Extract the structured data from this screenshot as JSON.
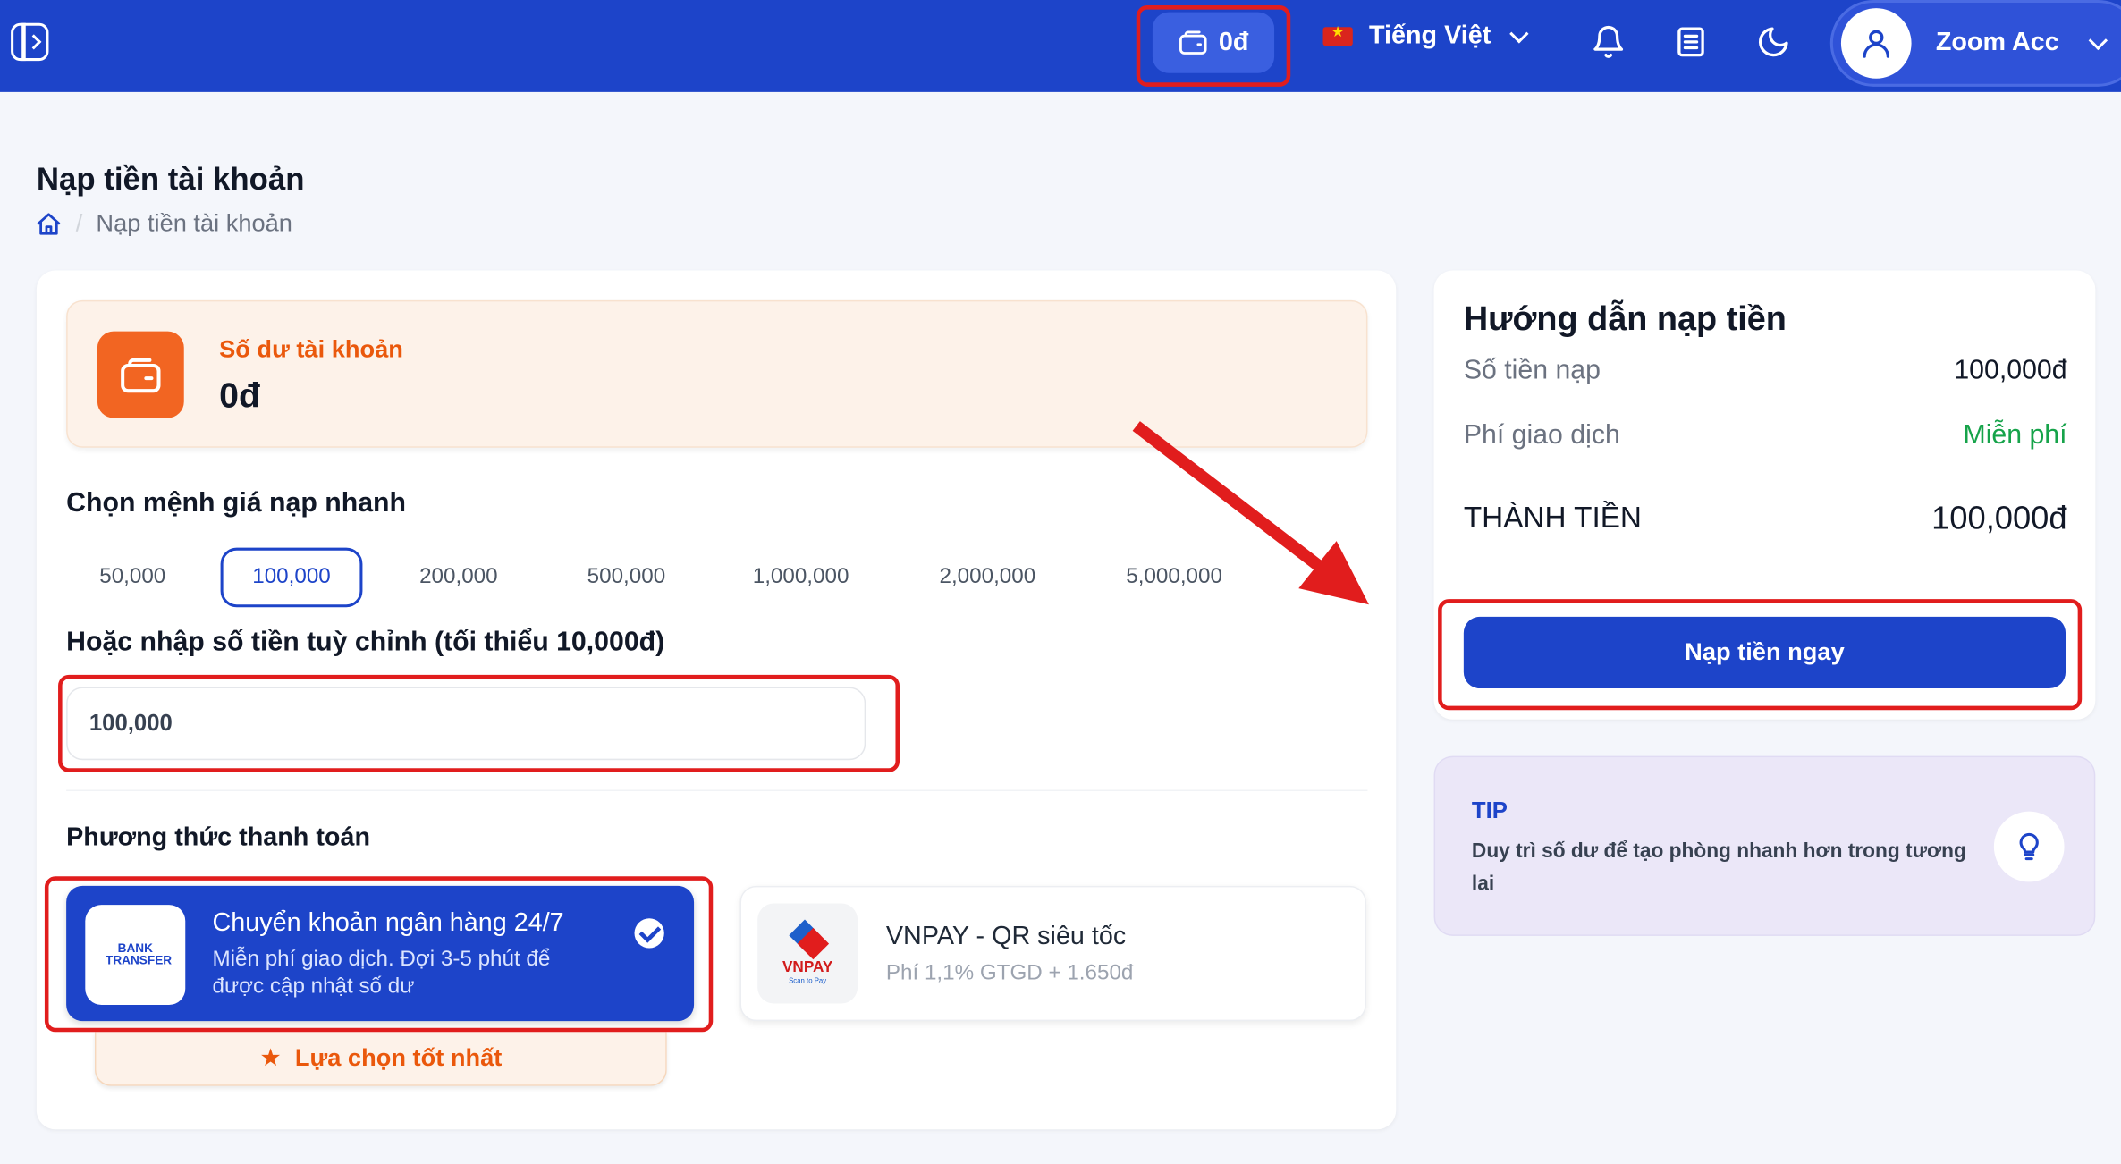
{
  "topbar": {
    "wallet_amount": "0đ",
    "language": "Tiếng Việt",
    "user_name": "Zoom Acc"
  },
  "page": {
    "title": "Nạp tiền tài khoản",
    "breadcrumb_current": "Nạp tiền tài khoản"
  },
  "balance": {
    "label": "Số dư tài khoản",
    "value": "0đ"
  },
  "quick_amounts": {
    "title": "Chọn mệnh giá nạp nhanh",
    "options": [
      "50,000",
      "100,000",
      "200,000",
      "500,000",
      "1,000,000",
      "2,000,000",
      "5,000,000"
    ],
    "selected": "100,000"
  },
  "custom_amount": {
    "title": "Hoặc nhập số tiền tuỳ chỉnh (tối thiểu 10,000đ)",
    "value": "100,000"
  },
  "payment": {
    "title": "Phương thức thanh toán",
    "methods": [
      {
        "name": "Chuyển khoản ngân hàng 24/7",
        "description": "Miễn phí giao dịch. Đợi 3-5 phút để được cập nhật số dư",
        "logo_text": "BANK TRANSFER",
        "selected": true
      },
      {
        "name": "VNPAY - QR siêu tốc",
        "description": "Phí 1,1% GTGD + 1.650đ",
        "logo_text": "VNPAY",
        "logo_sub": "Scan to Pay",
        "selected": false
      }
    ],
    "best_choice": "Lựa chọn tốt nhất"
  },
  "guide": {
    "title": "Hướng dẫn nạp tiền",
    "amount_label": "Số tiền nạp",
    "amount_value": "100,000đ",
    "fee_label": "Phí giao dịch",
    "fee_value": "Miễn phí",
    "total_label": "THÀNH TIỀN",
    "total_value": "100,000đ",
    "submit_label": "Nạp tiền ngay"
  },
  "tip": {
    "title": "TIP",
    "text": "Duy trì số dư để tạo phòng nhanh hơn trong tương lai"
  },
  "colors": {
    "primary": "#1d44c9",
    "accent_orange": "#f26522",
    "free_green": "#16a34a",
    "annotation_red": "#e11d1d"
  },
  "icons": [
    "sidebar-toggle-icon",
    "wallet-icon",
    "vietnam-flag-icon",
    "chevron-down-icon",
    "bell-icon",
    "document-icon",
    "moon-icon",
    "user-icon",
    "home-icon",
    "check-icon",
    "star-icon",
    "lightbulb-icon"
  ]
}
